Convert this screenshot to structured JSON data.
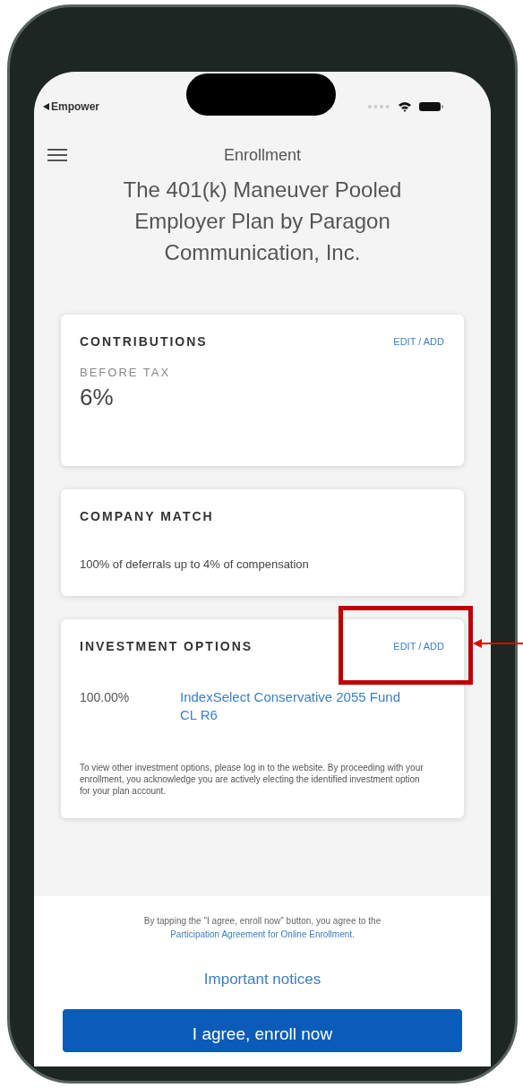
{
  "status_bar": {
    "back_label": "Empower"
  },
  "header": {
    "title": "Enrollment"
  },
  "plan_name": "The 401(k) Maneuver Pooled Employer Plan by Paragon Communication, Inc.",
  "cards": [
    {
      "kind": "contributions",
      "title": "CONTRIBUTIONS",
      "action": "EDIT / ADD",
      "label": "BEFORE TAX",
      "value": "6%"
    },
    {
      "kind": "match",
      "title": "COMPANY MATCH",
      "text": "100% of deferrals up to 4% of compensation"
    },
    {
      "kind": "investments",
      "title": "INVESTMENT OPTIONS",
      "action": "EDIT / ADD",
      "highlighted": true,
      "allocations": [
        {
          "percent": "100.00%",
          "fund": "IndexSelect Conservative 2055 Fund CL R6"
        }
      ],
      "note": "To view other investment options, please log in to the website. By proceeding with your enrollment, you acknowledge you are actively electing the identified investment option for your plan account."
    }
  ],
  "footer": {
    "agreement_text": "By tapping the \"I agree, enroll now\" button, you agree to the",
    "agreement_link": "Participation Agreement for Online Enrollment.",
    "notices_link": "Important notices",
    "primary_button": "I agree, enroll now"
  }
}
